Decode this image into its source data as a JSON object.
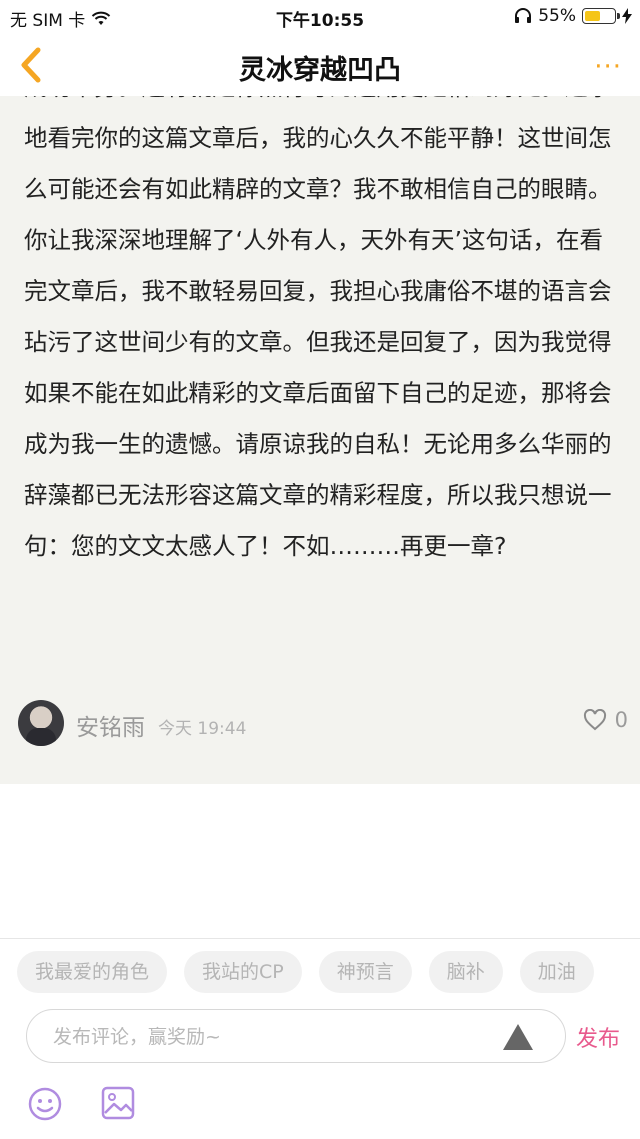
{
  "status_bar": {
    "carrier": "无 SIM 卡",
    "time": "下午10:55",
    "battery_percent": "55%",
    "battery_level": 0.55,
    "battery_color": "#f5c518"
  },
  "nav": {
    "title": "灵冰穿越凹凸",
    "back_icon": "chevron-left-icon",
    "more_label": "···",
    "accent": "#f5a623"
  },
  "comment": {
    "text": "成功举身。还有就是你点符号的运用更是恰到好处。逐字地看完你的这篇文章后，我的心久久不能平静！这世间怎么可能还会有如此精辟的文章？我不敢相信自己的眼睛。你让我深深地理解了‘人外有人，天外有天’这句话，在看完文章后，我不敢轻易回复，我担心我庸俗不堪的语言会玷污了这世间少有的文章。但我还是回复了，因为我觉得如果不能在如此精彩的文章后面留下自己的足迹，那将会成为我一生的遗憾。请原谅我的自私！无论用多么华丽的辞藻都已无法形容这篇文章的精彩程度，所以我只想说一句：您的文文太感人了！不如………再更一章?",
    "author": "安铭雨",
    "time": "今天 19:44",
    "likes": "0"
  },
  "quick_tags": [
    "我最爱的角色",
    "我站的CP",
    "神预言",
    "脑补",
    "加油"
  ],
  "composer": {
    "placeholder": "发布评论，赢奖励~",
    "publish_label": "发布",
    "publish_color": "#e85a8d",
    "icons": [
      "emoji-icon",
      "image-icon",
      "send-triangle-icon"
    ]
  }
}
